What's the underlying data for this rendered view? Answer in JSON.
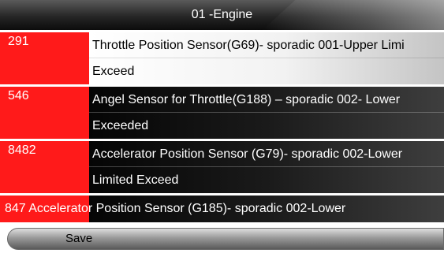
{
  "header": {
    "title": "01  -Engine"
  },
  "dtcs": [
    {
      "code": "291",
      "line1": "Throttle Position Sensor(G69)- sporadic 001-Upper Limi",
      "line2": "Exceed"
    },
    {
      "code": "546",
      "line1": "Angel Sensor for Throttle(G188) – sporadic 002- Lower",
      "line2": "Exceeded"
    },
    {
      "code": "8482",
      "line1": " Accelerator Position Sensor (G79)- sporadic 002-Lower",
      "line2": "Limited Exceed"
    },
    {
      "code": "847",
      "line1": "847 Accelerator Position Sensor (G185)- sporadic 002-Lower"
    }
  ],
  "footer": {
    "save_label": "Save"
  },
  "colors": {
    "code_bg": "#ff1a1a",
    "header_bg": "#262626",
    "selected_bg": "#ffffff"
  }
}
